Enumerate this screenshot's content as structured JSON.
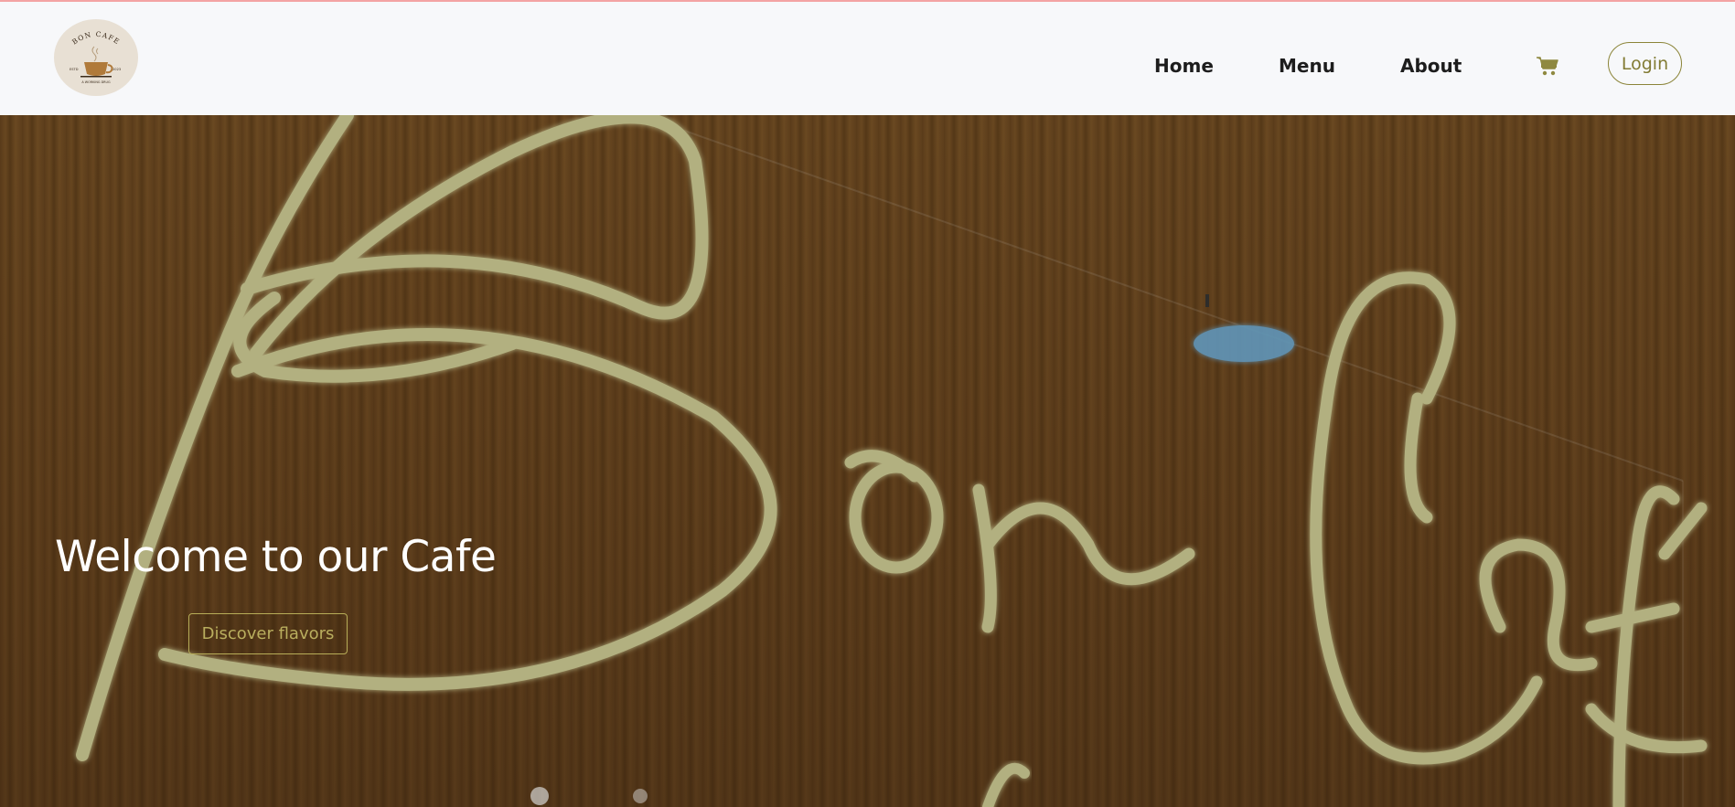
{
  "brand": {
    "logo_top_text": "BON CAFE",
    "logo_left_text": "ESTD",
    "logo_right_text": "2023",
    "logo_bottom_text": "A WORKING DRUG",
    "logo_icon": "coffee-cup-icon"
  },
  "nav": {
    "items": [
      {
        "label": "Home"
      },
      {
        "label": "Menu"
      },
      {
        "label": "About"
      }
    ],
    "cart_icon": "shopping-cart-icon",
    "login_label": "Login"
  },
  "hero": {
    "title": "Welcome to our Cafe",
    "cta_label": "Discover flavors",
    "background_image": "neon sign on wood wall"
  },
  "colors": {
    "navbar_bg": "#f7f8fa",
    "accent": "#827b34",
    "neon": "#d9d7a0",
    "wood": "#6b4a26",
    "lamp_blue": "#6fb3e0"
  }
}
